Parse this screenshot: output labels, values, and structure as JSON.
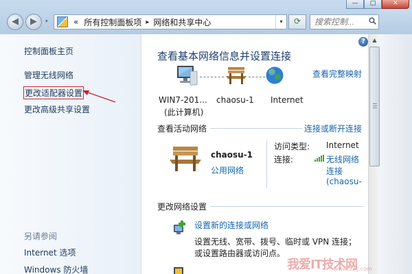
{
  "window": {
    "min_glyph": "—",
    "max_glyph": "□",
    "close_glyph": "✕"
  },
  "navbar": {
    "back_glyph": "◀",
    "forward_glyph": "▶",
    "dropdown_glyph": "▾",
    "address_segments": [
      "«",
      "所有控制面板项",
      "网络和共享中心"
    ],
    "separator_glyph": "▸",
    "address_dropdown_glyph": "▾",
    "refresh_glyph": "⟳",
    "search_placeholder": "搜索控制..."
  },
  "left_pane": {
    "home": "控制面板主页",
    "wireless": "管理无线网络",
    "adapter": "更改适配器设置",
    "advanced": "更改高级共享设置",
    "see_also": "另请参阅",
    "internet_options": "Internet 选项",
    "firewall": "Windows 防火墙"
  },
  "main": {
    "help_glyph": "?",
    "title": "查看基本网络信息并设置连接",
    "view_full_map": "查看完整映射",
    "map": {
      "computer_line1": "WIN7-201...",
      "computer_line2": "(此计算机)",
      "network": "chaosu-1",
      "internet": "Internet"
    },
    "active_networks": {
      "heading": "查看活动网络",
      "connect_link": "连接或断开连接",
      "network_name": "chaosu-1",
      "network_type": "公用网络",
      "access_type_label": "访问类型:",
      "access_type_value": "Internet",
      "connection_label": "连接:",
      "connection_line1": "无线网络",
      "connection_line2": "连接",
      "connection_line3": "(chaosu-"
    },
    "change_settings": {
      "heading": "更改网络设置",
      "setup_link": "设置新的连接或网络",
      "setup_desc1": "设置无线、宽带、拨号、临时或 VPN 连接；",
      "setup_desc2": "或设置路由器或访问点。"
    }
  },
  "watermark": {
    "text": "我爱IT技术网",
    "url": "www.52ij.com"
  },
  "colors": {
    "link": "#1565b0",
    "title": "#1e3f6f",
    "highlight_box": "#d4262b",
    "arrow": "#c8202a"
  }
}
